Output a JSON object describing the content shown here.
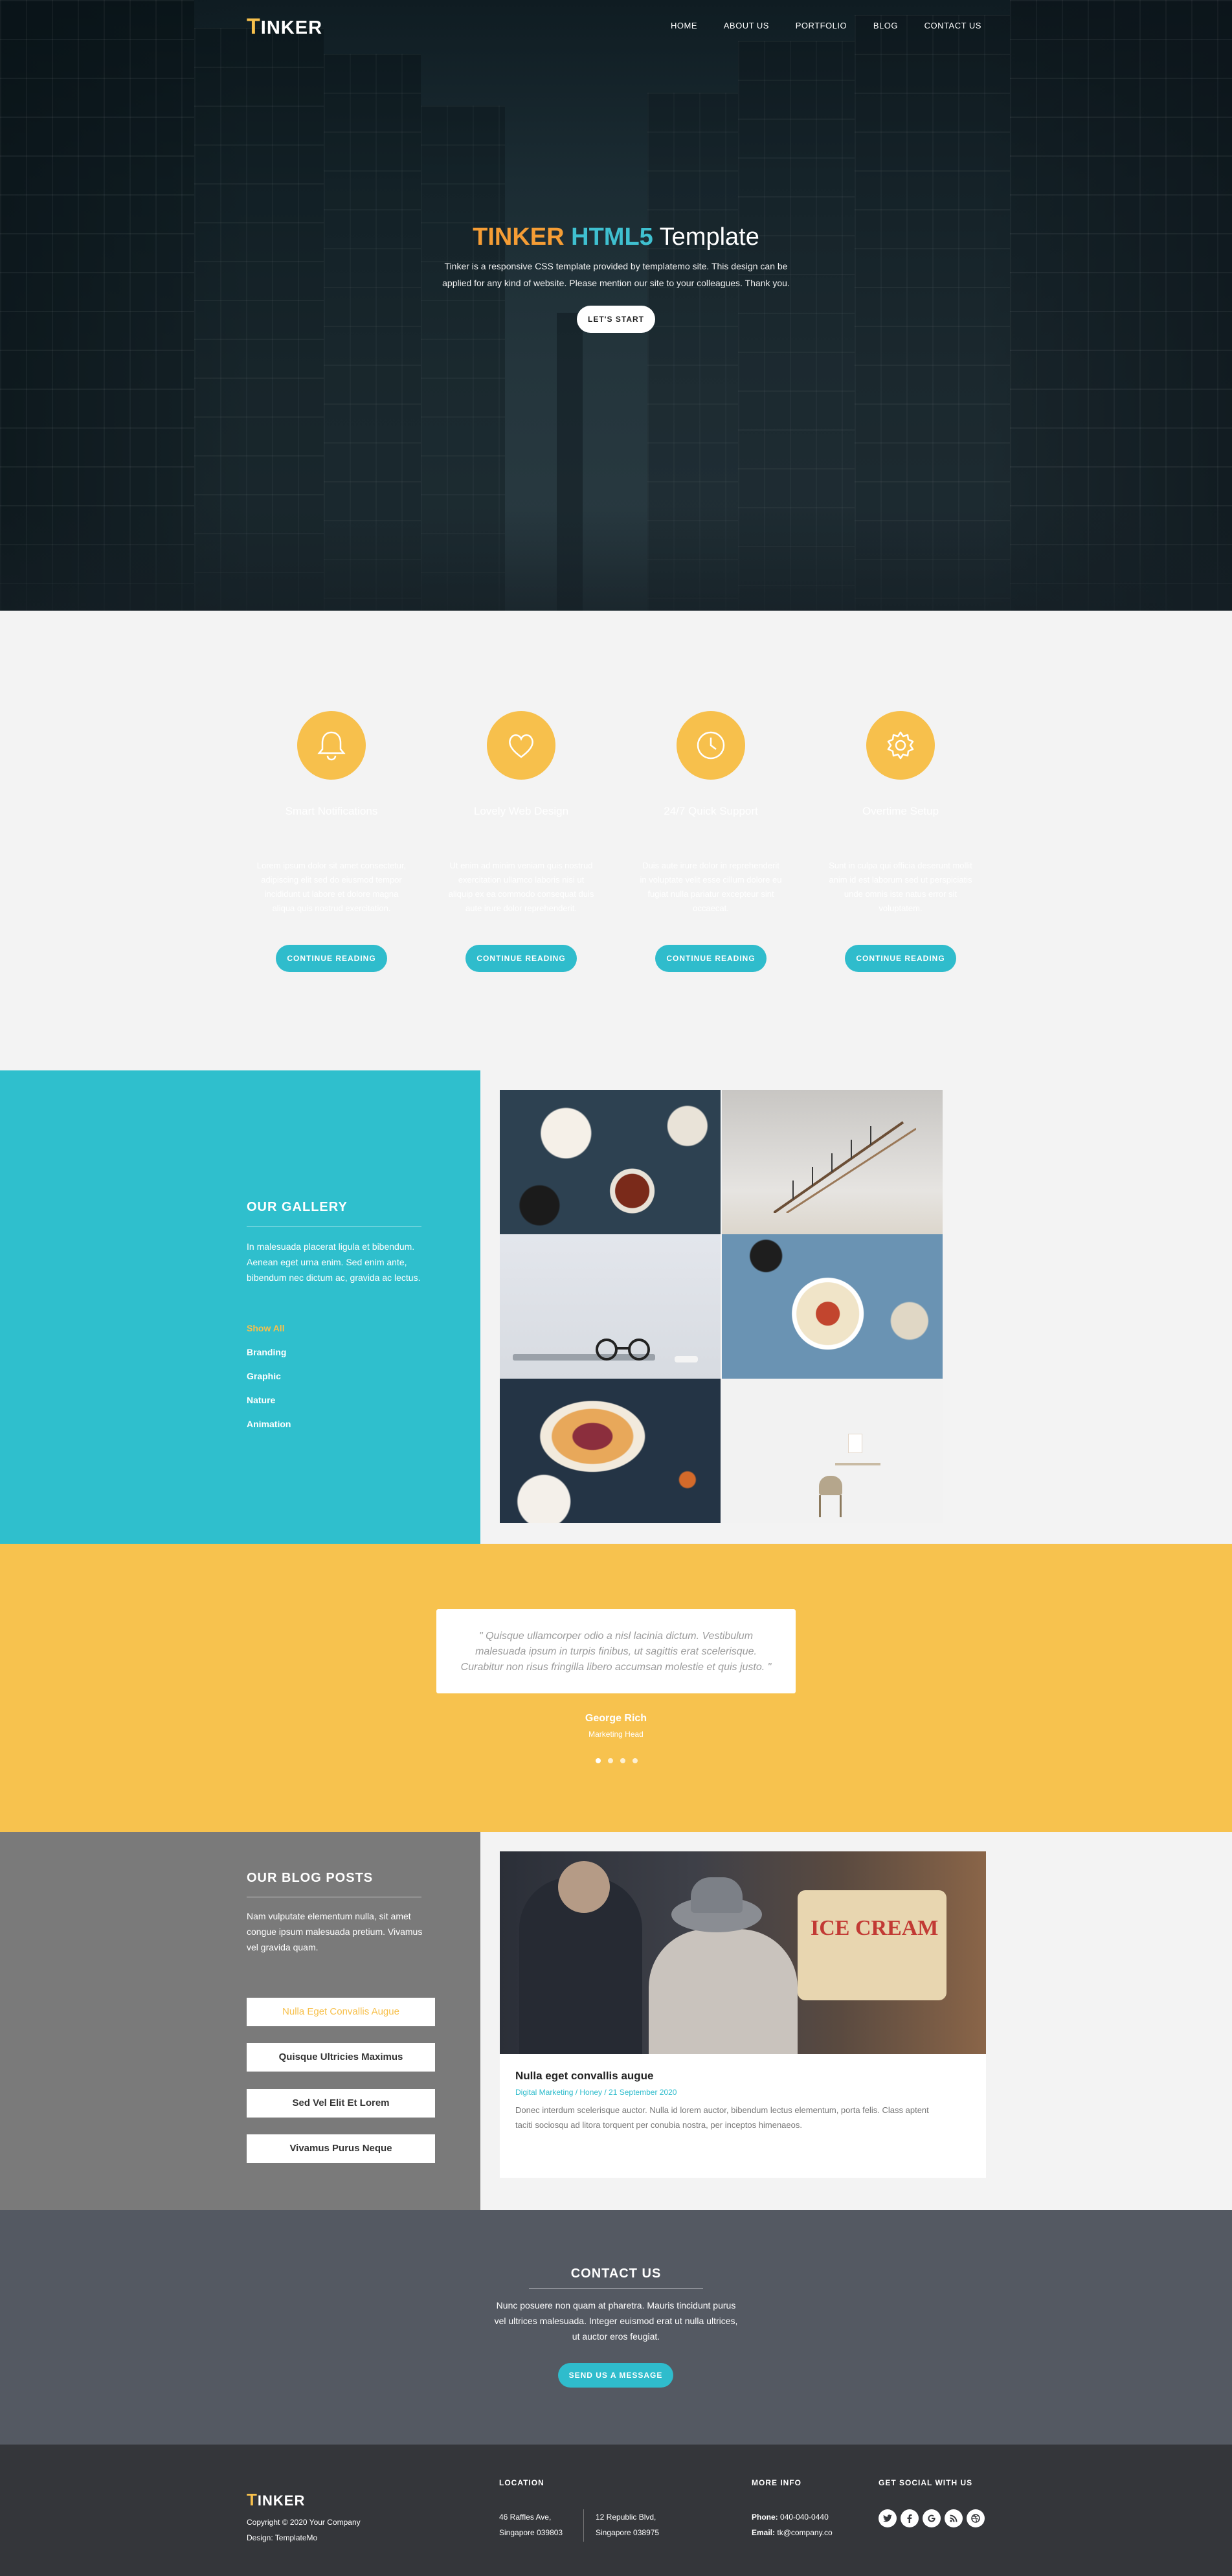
{
  "brand": {
    "logo_first": "T",
    "logo_rest": "INKER"
  },
  "nav": {
    "items": [
      "HOME",
      "ABOUT US",
      "PORTFOLIO",
      "BLOG",
      "CONTACT US"
    ]
  },
  "hero": {
    "title_part1": "TINKER",
    "title_part2": "HTML5",
    "title_part3": "Template",
    "desc_line1": "Tinker is a responsive CSS template provided by templatemo site. This design can be",
    "desc_line2": "applied for any kind of website. Please mention our site to your colleagues. Thank you.",
    "cta": "LET'S START"
  },
  "features": [
    {
      "icon": "bell-icon",
      "title": "Smart Notifications",
      "text_lines": [
        "Lorem ipsum dolor sit amet consectetur,",
        "adipiscing elit sed do eiusmod tempor",
        "incididunt ut labore et dolore magna",
        "aliqua quis nostrud exercitation."
      ],
      "button": "CONTINUE READING"
    },
    {
      "icon": "heart-icon",
      "title": "Lovely Web Design",
      "text_lines": [
        "Ut enim ad minim veniam quis nostrud",
        "exercitation ullamco laboris nisi ut",
        "aliquip ex ea commodo consequat duis",
        "aute irure dolor reprehenderit."
      ],
      "button": "CONTINUE READING"
    },
    {
      "icon": "clock-icon",
      "title": "24/7 Quick Support",
      "text_lines": [
        "Duis aute irure dolor in reprehenderit",
        "in voluptate velit esse cillum dolore eu",
        "fugiat nulla pariatur excepteur sint",
        "occaecat."
      ],
      "button": "CONTINUE READING"
    },
    {
      "icon": "gear-icon",
      "title": "Overtime Setup",
      "text_lines": [
        "Sunt in culpa qui officia deserunt mollit",
        "anim id est laborum sed ut perspiciatis",
        "unde omnis iste natus error sit",
        "voluptatem."
      ],
      "button": "CONTINUE READING"
    }
  ],
  "gallery": {
    "title": "OUR GALLERY",
    "text_lines": [
      "In malesuada placerat ligula et bibendum.",
      "Aenean eget urna enim. Sed enim ante,",
      "bibendum nec dictum ac, gravida ac lectus."
    ],
    "filters": [
      "Show All",
      "Branding",
      "Graphic",
      "Nature",
      "Animation"
    ],
    "active_filter": "Show All"
  },
  "testimonial": {
    "quote_lines": [
      "\" Quisque ullamcorper odio a nisl lacinia dictum. Vestibulum",
      "malesuada ipsum in turpis finibus, ut sagittis erat scelerisque.",
      "Curabitur non risus fringilla libero accumsan molestie et quis justo. \""
    ],
    "name": "George Rich",
    "role": "Marketing Head",
    "dots_count": 4,
    "active_dot": 0
  },
  "blog": {
    "title": "OUR BLOG POSTS",
    "text_lines": [
      "Nam vulputate elementum nulla, sit amet",
      "congue ipsum malesuada pretium. Vivamus",
      "vel gravida quam."
    ],
    "posts": [
      "Nulla Eget Convallis Augue",
      "Quisque Ultricies Maximus",
      "Sed Vel Elit Et Lorem",
      "Vivamus Purus Neque"
    ],
    "card": {
      "title": "Nulla eget convallis augue",
      "meta": "Digital Marketing / Honey / 21 September 2020",
      "text_line1": "Donec interdum scelerisque auctor. Nulla id lorem auctor, bibendum lectus elementum, porta felis. Class aptent",
      "text_line2": "taciti sociosqu ad litora torquent per conubia nostra, per inceptos himenaeos."
    }
  },
  "contact": {
    "title": "CONTACT US",
    "text_lines": [
      "Nunc posuere non quam at pharetra. Mauris tincidunt purus",
      "vel ultrices malesuada. Integer euismod erat ut nulla ultrices,",
      "ut auctor eros feugiat."
    ],
    "button": "SEND US A MESSAGE"
  },
  "footer": {
    "copyright": "Copyright © 2020 Your Company",
    "design": "Design: TemplateMo",
    "location_head": "LOCATION",
    "address1_line1": "46 Raffles Ave,",
    "address1_line2": "Singapore 039803",
    "address2_line1": "12 Republic Blvd,",
    "address2_line2": "Singapore 038975",
    "more_head": "MORE INFO",
    "phone_label": "Phone:",
    "phone": "040-040-0440",
    "email_label": "Email:",
    "email": "tk@company.co",
    "social_head": "GET SOCIAL WITH US",
    "social_icons": [
      "twitter-icon",
      "facebook-icon",
      "google-icon",
      "rss-icon",
      "dribbble-icon"
    ]
  },
  "colors": {
    "accent_yellow": "#f7c04c",
    "accent_teal": "#2fbccc",
    "orange": "#f59d35"
  }
}
